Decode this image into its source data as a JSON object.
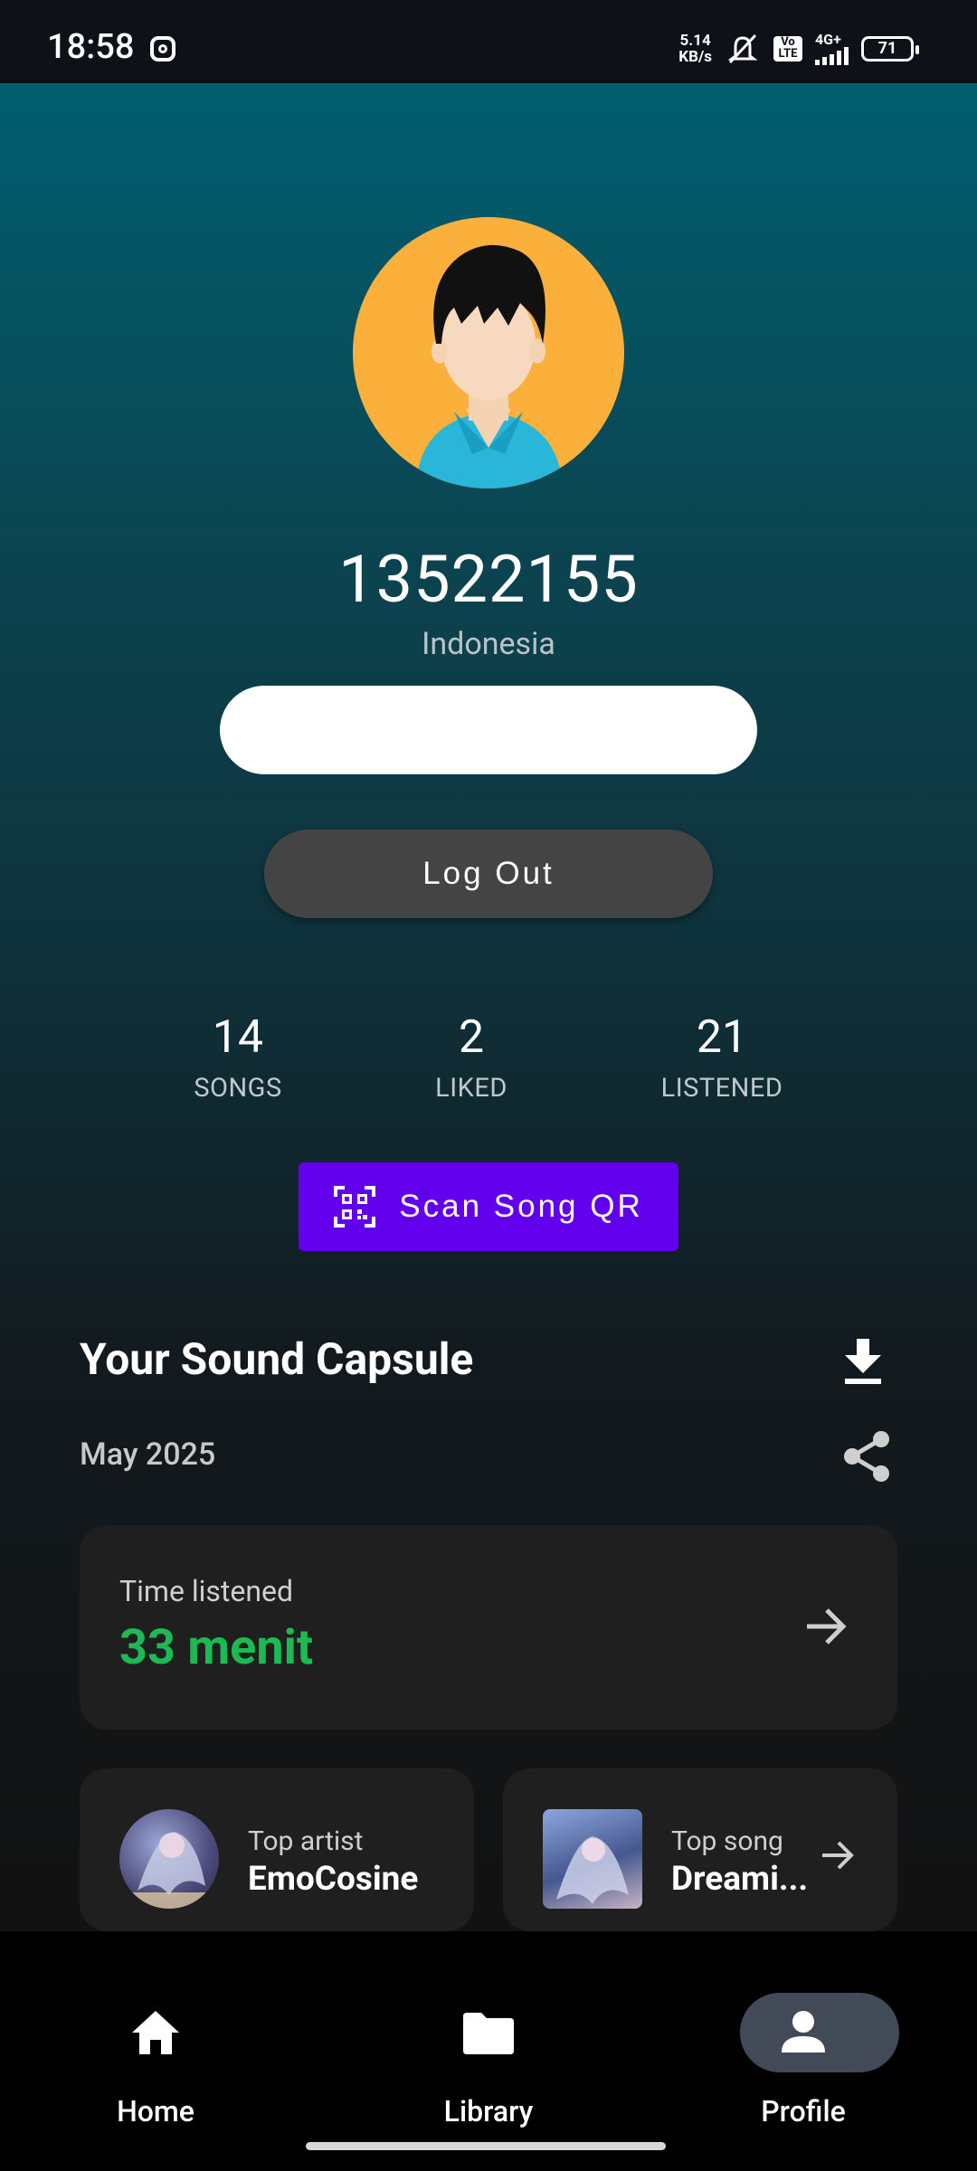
{
  "status_bar": {
    "time": "18:58",
    "net_speed_value": "5.14",
    "net_speed_unit": "KB/s",
    "volte_label": "Vo LTE",
    "network_type": "4G+",
    "battery": "71",
    "icons": [
      "instagram-icon",
      "mute-icon",
      "volte-icon",
      "signal-icon",
      "battery-icon"
    ]
  },
  "profile": {
    "username": "13522155",
    "country": "Indonesia",
    "logout_label": "Log Out"
  },
  "stats": [
    {
      "value": "14",
      "label": "SONGS"
    },
    {
      "value": "2",
      "label": "LIKED"
    },
    {
      "value": "21",
      "label": "LISTENED"
    }
  ],
  "scan_button": {
    "label": "Scan Song QR",
    "icon": "qr-scan-icon"
  },
  "sound_capsule": {
    "title": "Your Sound Capsule",
    "month": "May 2025",
    "time_listened": {
      "label": "Time listened",
      "value": "33 menit"
    },
    "top_artist": {
      "label": "Top artist",
      "value": "EmoCosine"
    },
    "top_song": {
      "label": "Top song",
      "value": "Dreami..."
    }
  },
  "nav": {
    "items": [
      {
        "label": "Home",
        "icon": "home-icon",
        "active": false
      },
      {
        "label": "Library",
        "icon": "folder-icon",
        "active": false
      },
      {
        "label": "Profile",
        "icon": "person-icon",
        "active": true
      }
    ]
  },
  "colors": {
    "accent_purple": "#6200ee",
    "accent_green": "#1db954",
    "avatar_bg": "#fbb03b",
    "nav_active_pill": "#424a57"
  }
}
